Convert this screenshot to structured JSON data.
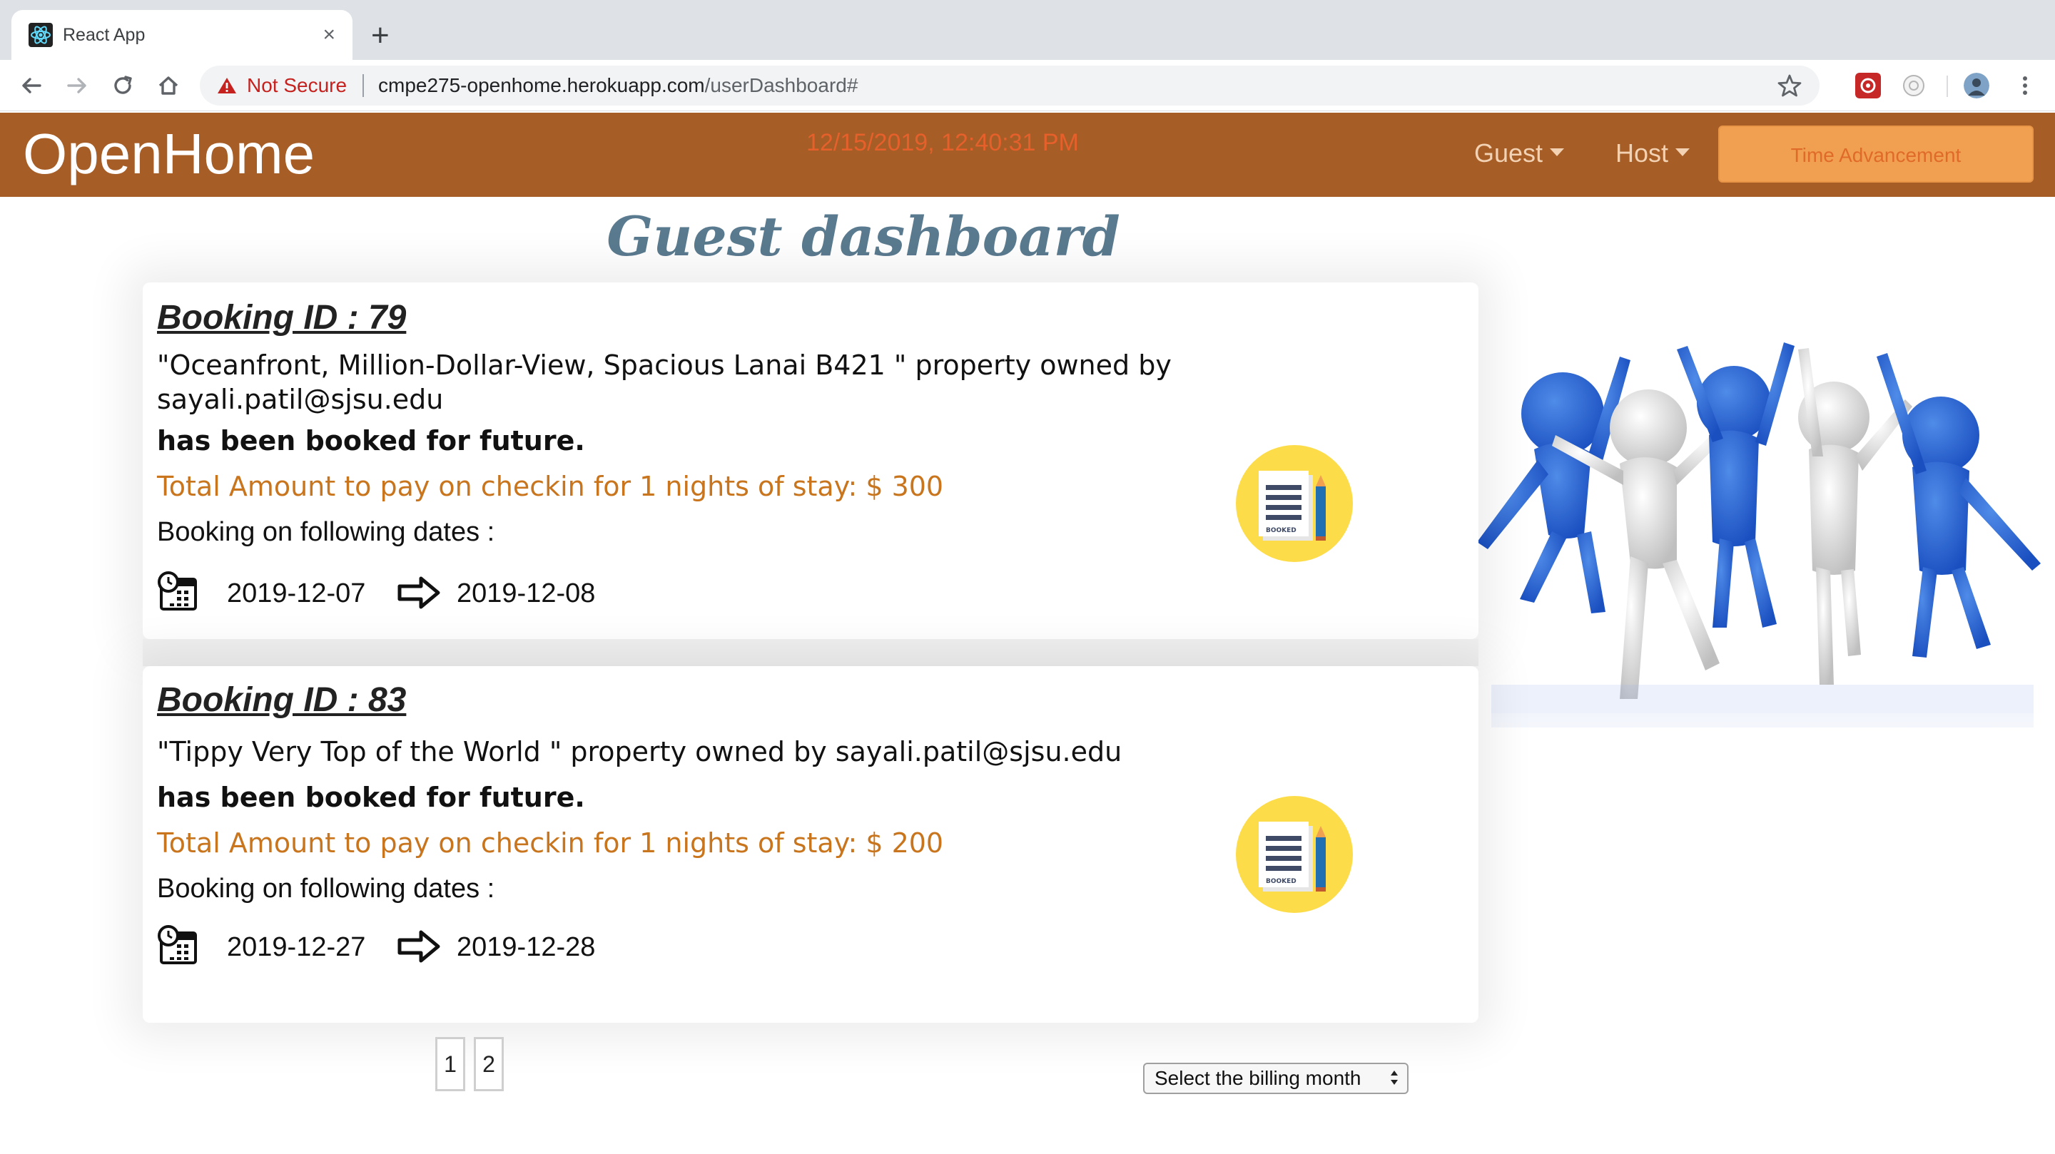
{
  "browser": {
    "tab_title": "React App",
    "tab_close": "×",
    "new_tab": "+",
    "security_label": "Not Secure",
    "url_host": "cmpe275-openhome.herokuapp.com",
    "url_path": "/userDashboard#"
  },
  "navbar": {
    "brand": "OpenHome",
    "clock": "12/15/2019, 12:40:31 PM",
    "guest_label": "Guest",
    "host_label": "Host",
    "time_button": "Time Advancement"
  },
  "page": {
    "title": "Guest dashboard"
  },
  "bookings": [
    {
      "id_label": "Booking ID : 79",
      "description": "\"Oceanfront, Million-Dollar-View, Spacious Lanai B421 \" property owned by sayali.patil@sjsu.edu",
      "status": "has been booked for future.",
      "amount": "Total Amount to pay on checkin for 1 nights of stay: $ 300",
      "dates_label": "Booking on following dates :",
      "checkin": "2019-12-07",
      "checkout": "2019-12-08",
      "badge_text": "BOOKED"
    },
    {
      "id_label": "Booking ID : 83",
      "description": "\"Tippy Very Top of the World \" property owned by sayali.patil@sjsu.edu",
      "status": "has been booked for future.",
      "amount": "Total Amount to pay on checkin for 1 nights of stay: $ 200",
      "dates_label": "Booking on following dates :",
      "checkin": "2019-12-27",
      "checkout": "2019-12-28",
      "badge_text": "BOOKED"
    }
  ],
  "pagination": {
    "pages": [
      "1",
      "2"
    ]
  },
  "billing": {
    "placeholder": "Select the billing month"
  },
  "colors": {
    "navbar": "#a65d26",
    "accent_button": "#f0a050",
    "amount_text": "#c8751e",
    "title_text": "#5a7a8f"
  }
}
